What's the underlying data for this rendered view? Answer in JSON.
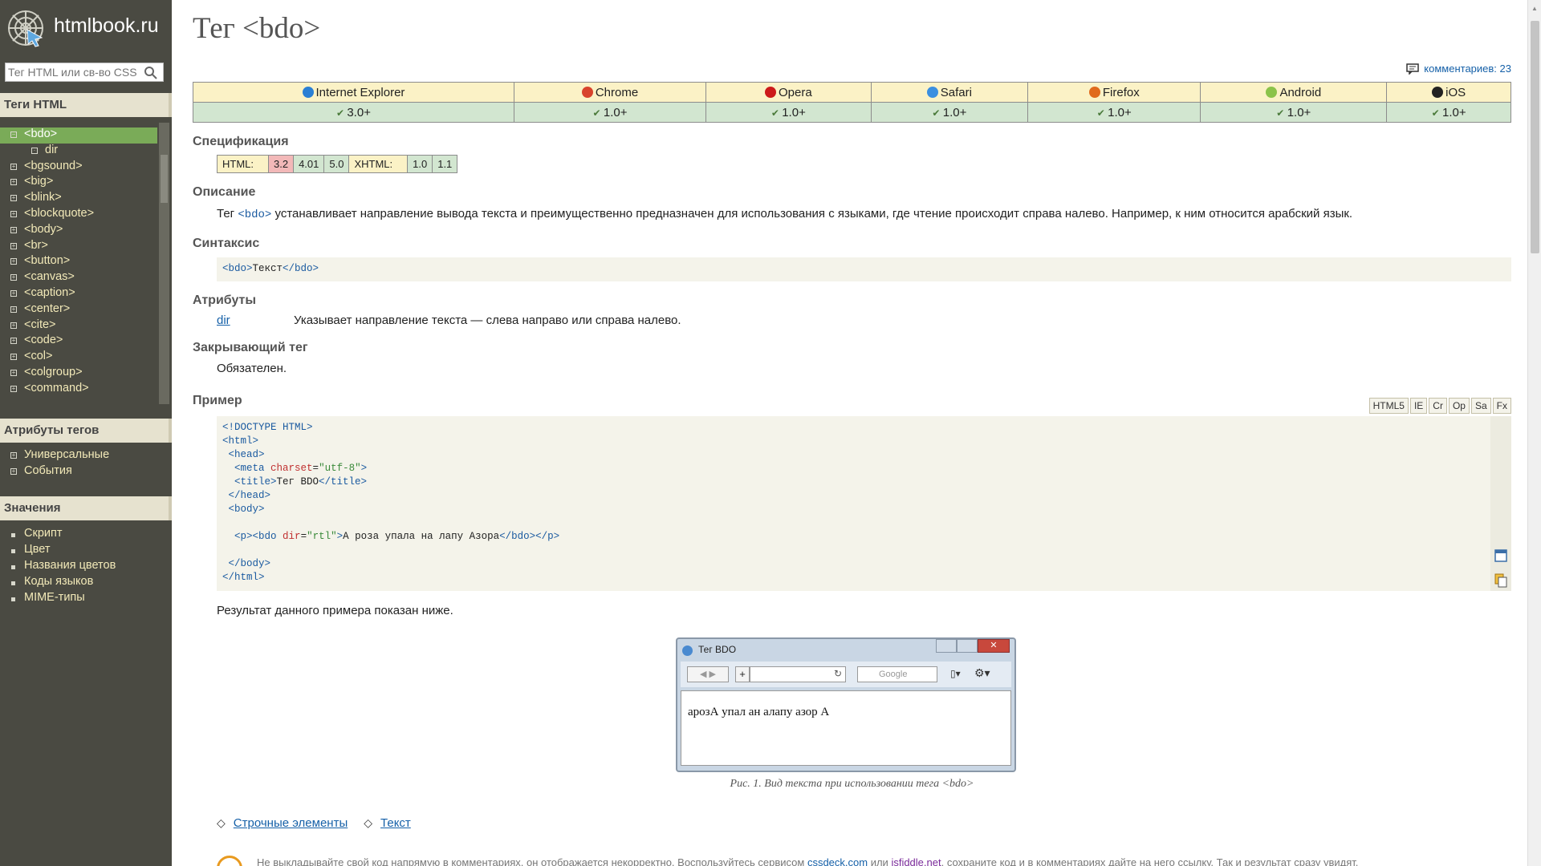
{
  "site": {
    "name": "htmlbook.ru",
    "search_placeholder": "Тег HTML или св-во CSS"
  },
  "sidebar": {
    "tags_heading": "Теги HTML",
    "tree": [
      {
        "label": "<bdo>",
        "active": true,
        "sign": "−"
      },
      {
        "label": "dir",
        "sub": true,
        "sign": "·"
      },
      {
        "label": "<bgsound>",
        "sign": "+"
      },
      {
        "label": "<big>",
        "sign": "+"
      },
      {
        "label": "<blink>",
        "sign": "+"
      },
      {
        "label": "<blockquote>",
        "sign": "+"
      },
      {
        "label": "<body>",
        "sign": "+"
      },
      {
        "label": "<br>",
        "sign": "+"
      },
      {
        "label": "<button>",
        "sign": "+"
      },
      {
        "label": "<canvas>",
        "sign": "+"
      },
      {
        "label": "<caption>",
        "sign": "+"
      },
      {
        "label": "<center>",
        "sign": "+"
      },
      {
        "label": "<cite>",
        "sign": "+"
      },
      {
        "label": "<code>",
        "sign": "+"
      },
      {
        "label": "<col>",
        "sign": "+"
      },
      {
        "label": "<colgroup>",
        "sign": "+"
      },
      {
        "label": "<command>",
        "sign": "+"
      }
    ],
    "attrs_heading": "Атрибуты тегов",
    "attrs": [
      "Универсальные",
      "События"
    ],
    "values_heading": "Значения",
    "values": [
      "Скрипт",
      "Цвет",
      "Названия цветов",
      "Коды языков",
      "MIME-типы"
    ]
  },
  "page": {
    "title": "Тег <bdo>",
    "comments": "комментариев: 23",
    "browsers": [
      {
        "name": "Internet Explorer",
        "version": "3.0+",
        "color": "#2a7fd4"
      },
      {
        "name": "Chrome",
        "version": "1.0+",
        "color": "#d8432c"
      },
      {
        "name": "Opera",
        "version": "1.0+",
        "color": "#cc1a1a"
      },
      {
        "name": "Safari",
        "version": "1.0+",
        "color": "#3b8fe0"
      },
      {
        "name": "Firefox",
        "version": "1.0+",
        "color": "#e06a1c"
      },
      {
        "name": "Android",
        "version": "1.0+",
        "color": "#8bc34a"
      },
      {
        "name": "iOS",
        "version": "1.0+",
        "color": "#222222"
      }
    ],
    "spec_heading": "Спецификация",
    "spec": {
      "html_label": "HTML:",
      "html_versions": [
        "3.2",
        "4.01",
        "5.0"
      ],
      "xhtml_label": "XHTML:",
      "xhtml_versions": [
        "1.0",
        "1.1"
      ]
    },
    "desc_heading": "Описание",
    "desc_pre": "Тег ",
    "desc_tag": "<bdo>",
    "desc_post": " устанавливает направление вывода текста и преимущественно предназначен для использования с языками, где чтение происходит справа налево. Например, к ним относится арабский язык.",
    "syntax_heading": "Синтаксис",
    "syntax_open": "<bdo>",
    "syntax_text": "Текст",
    "syntax_close": "</bdo>",
    "attrs_heading": "Атрибуты",
    "attr_name": "dir",
    "attr_desc": "Указывает направление текста — слева направо или справа налево.",
    "closing_heading": "Закрывающий тег",
    "closing_text": "Обязателен.",
    "example_heading": "Пример",
    "example_tabs": [
      "HTML5",
      "IE",
      "Cr",
      "Op",
      "Sa",
      "Fx"
    ],
    "code": {
      "l1": "<!DOCTYPE HTML>",
      "l2": "<html>",
      "l3": "<head>",
      "l4_open": "<meta ",
      "l4_attr": "charset",
      "l4_eq": "=",
      "l4_val": "\"utf-8\"",
      "l4_close": ">",
      "l5_open": "<title>",
      "l5_text": "Тег BDO",
      "l5_close": "</title>",
      "l6": "</head>",
      "l7": "<body>",
      "l9_p": "<p>",
      "l9_bdo": "<bdo ",
      "l9_attr": "dir",
      "l9_eq": "=",
      "l9_val": "\"rtl\"",
      "l9_gt": ">",
      "l9_text": "А роза упала на лапу Азора",
      "l9_cbdo": "</bdo>",
      "l9_cp": "</p>",
      "l11": "</body>",
      "l12": "</html>"
    },
    "result_text": "Результат данного примера показан ниже.",
    "window_title": "Тег BDO",
    "window_search": "Google",
    "window_content": "арозА упал ан алапу азор А",
    "caption": "Рис. 1. Вид текста при использовании тега <bdo>",
    "tag_links": [
      "Строчные элементы",
      "Текст"
    ],
    "note_pre": "Не выкладывайте свой код напрямую в комментариях, он отображается некорректно. Воспользуйтесь сервисом ",
    "note_link1": "cssdeck.com",
    "note_mid": " или ",
    "note_link2": "jsfiddle.net",
    "note_post": ", сохраните код и в комментариях дайте на него ссылку. Так и результат сразу увидят."
  }
}
